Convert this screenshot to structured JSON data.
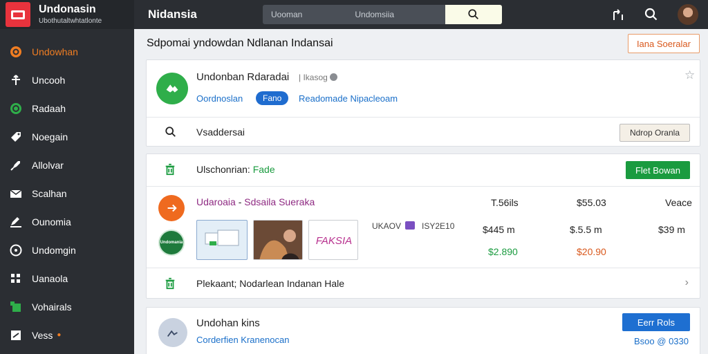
{
  "brand": {
    "title": "Undonasin",
    "subtitle": "Ubothutaltwhtatlonte"
  },
  "sidebar": {
    "items": [
      {
        "label": "Undowhan",
        "icon": "orange-circle-icon",
        "active": true
      },
      {
        "label": "Uncooh",
        "icon": "pin-icon"
      },
      {
        "label": "Radaah",
        "icon": "green-circle-icon"
      },
      {
        "label": "Noegain",
        "icon": "tag-icon"
      },
      {
        "label": "Allolvar",
        "icon": "rocket-icon"
      },
      {
        "label": "Scalhan",
        "icon": "mail-icon"
      },
      {
        "label": "Ounomia",
        "icon": "edit-icon"
      },
      {
        "label": "Undomgin",
        "icon": "clock-icon"
      },
      {
        "label": "Uanaola",
        "icon": "grid-icon"
      },
      {
        "label": "Vohairals",
        "icon": "green-square-icon"
      },
      {
        "label": "Vess",
        "icon": "box-icon"
      }
    ]
  },
  "topbar": {
    "title": "Nidansia",
    "search_left": "Uooman",
    "search_mid": "Undomsiia"
  },
  "page": {
    "title": "Sdpomai yndowdan Ndlanan Indansai",
    "header_button": "Iana Soeralar"
  },
  "card1": {
    "title": "Undonban Rdaradai",
    "meta": "Ikasog",
    "link1": "Oordnoslan",
    "pill": "Fano",
    "link2": "Readomade Nipacleoam",
    "search_text": "Vsaddersai",
    "search_button": "Ndrop Oranla"
  },
  "card2": {
    "header_prefix": "Ulschonrian: ",
    "header_highlight": "Fade",
    "header_button": "Flet Bowan",
    "row_title_a": "Udaroaia",
    "row_title_sep": " - ",
    "row_title_b": "Sdsaila Sueraka",
    "col1_head": "T.56ils",
    "col2_head": "$55.03",
    "col3_head": "Veace",
    "meta_a": "UKAOV",
    "meta_b": "ISY2E10",
    "thumb3_text": "FAKSIA",
    "badge_text": "Undomania",
    "col1_val": "$445 m",
    "col2_val": "$.5.5 m",
    "col3_val": "$39 m",
    "col1_price": "$2.890",
    "col2_price": "$20.90",
    "footer_text": "Plekaant; Nodarlean Indanan Hale"
  },
  "card3": {
    "title": "Undohan kins",
    "link": "Corderfien Kranenocan",
    "button": "Eerr Rols",
    "sub_button": "Bsoo @ 0330"
  },
  "colors": {
    "accent_orange": "#f07d22",
    "brand_red": "#e8333d",
    "green": "#1a9b3f",
    "blue": "#1e6fd1",
    "sidebar_bg": "#2b2e33"
  }
}
